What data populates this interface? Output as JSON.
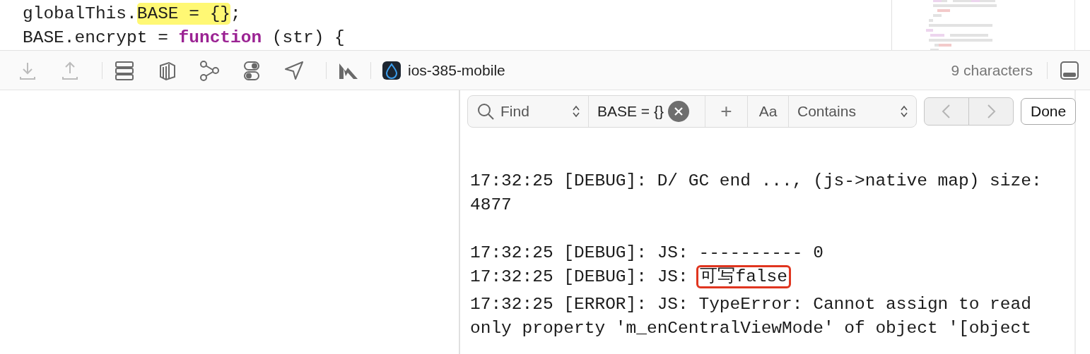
{
  "editor": {
    "lines": [
      [
        {
          "kind": "plain",
          "text": "globalThis."
        },
        {
          "kind": "match",
          "text": "BASE = {}"
        },
        {
          "kind": "plain",
          "text": ";"
        }
      ],
      [
        {
          "kind": "plain",
          "text": "BASE.encrypt = "
        },
        {
          "kind": "keyword",
          "text": "function"
        },
        {
          "kind": "plain",
          "text": " (str) {"
        }
      ]
    ]
  },
  "toolbar": {
    "scheme": "ios-385-mobile",
    "status": "9 characters"
  },
  "find_bar": {
    "mode": "Find",
    "query": "BASE = {}",
    "add": "+",
    "case": "Aa",
    "match": "Contains",
    "done": "Done"
  },
  "console": {
    "groups": [
      [
        [
          {
            "kind": "plain",
            "text": "17:32:25 [DEBUG]: D/ GC end ..., (js->native map) size: 4877"
          }
        ]
      ],
      [
        [
          {
            "kind": "plain",
            "text": "17:32:25 [DEBUG]: JS: ---------- 0"
          }
        ],
        [
          {
            "kind": "plain",
            "text": "17:32:25 [DEBUG]: JS: "
          },
          {
            "kind": "boxed",
            "text": "可写false"
          }
        ],
        [
          {
            "kind": "plain",
            "text": "17:32:25 [ERROR]: JS: TypeError: Cannot assign to read only property 'm_enCentralViewMode' of object '[object"
          }
        ]
      ]
    ]
  }
}
